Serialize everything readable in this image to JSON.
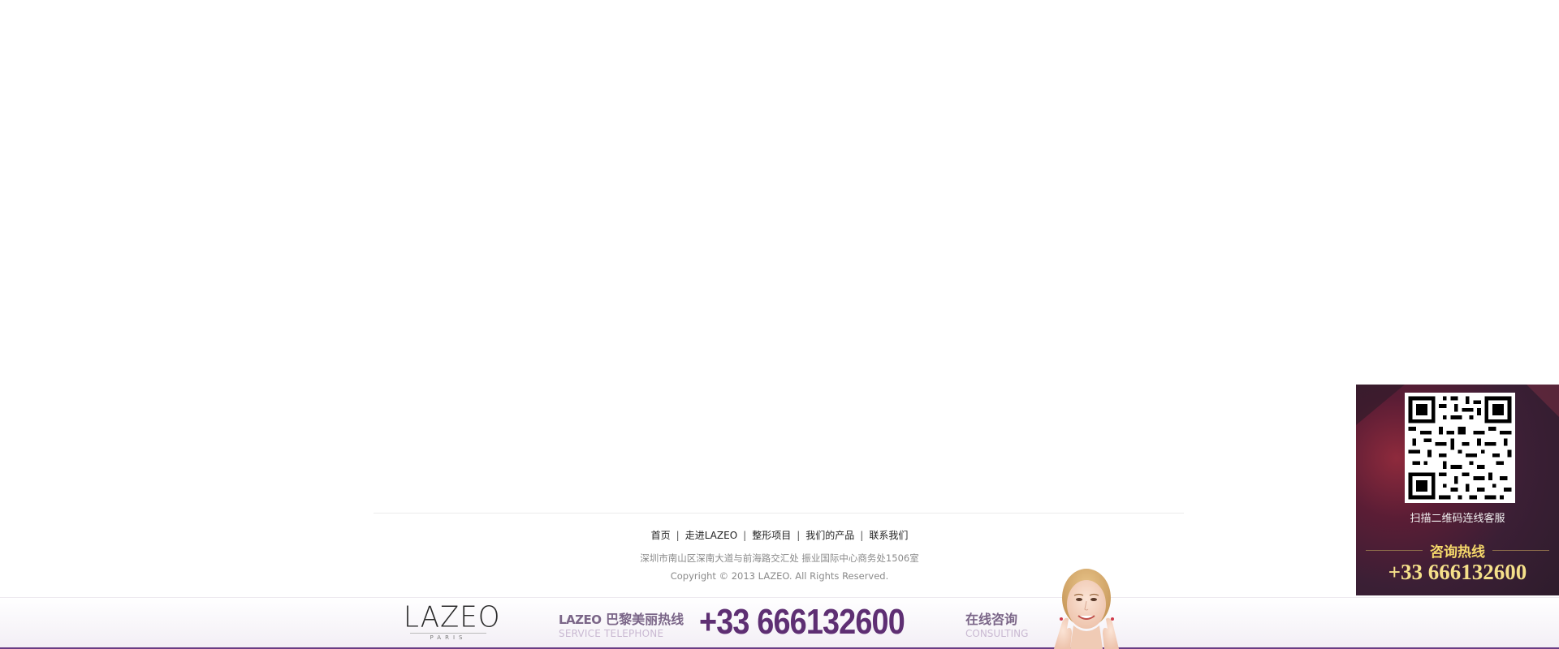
{
  "footer": {
    "nav": [
      {
        "label": "首页"
      },
      {
        "label": "走进LAZEO"
      },
      {
        "label": "整形项目"
      },
      {
        "label": "我们的产品"
      },
      {
        "label": "联系我们"
      }
    ],
    "separator": "|",
    "address": "深圳市南山区深南大道与前海路交汇处 振业国际中心商务处1506室",
    "copyright": "Copyright © 2013 LAZEO. All Rights Reserved."
  },
  "hotline_bar": {
    "logo_text": "LAZEO",
    "logo_sub": "PARIS",
    "hotline_brand": "LAZEO",
    "hotline_cn": "巴黎美丽热线",
    "hotline_en": "SERVICE TELEPHONE",
    "phone": "+33 666132600",
    "consult_cn": "在线咨询",
    "consult_en": "CONSULTING",
    "accent_color": "#5e2f73"
  },
  "qr_widget": {
    "caption": "扫描二维码连线客服",
    "hotline_title": "咨询热线",
    "phone": "+33 666132600",
    "highlight_color": "#f5d86a"
  },
  "icons": [
    "qr-code-icon",
    "face-photo"
  ]
}
